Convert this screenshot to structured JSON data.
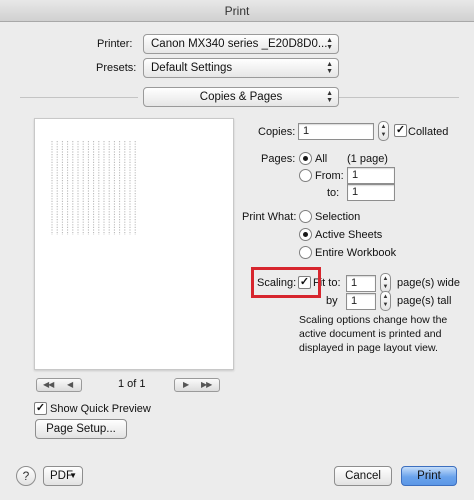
{
  "window": {
    "title": "Print"
  },
  "printer": {
    "label": "Printer:",
    "value": "Canon MX340 series _E20D8D0..."
  },
  "presets": {
    "label": "Presets:",
    "value": "Default Settings"
  },
  "section_popup": {
    "value": "Copies & Pages"
  },
  "pager": {
    "first": "◀◀",
    "prev": "◀",
    "page": "1 of 1",
    "next": "▶",
    "last": "▶▶"
  },
  "quick_preview": {
    "label": "Show Quick Preview",
    "checked": true
  },
  "page_setup": {
    "label": "Page Setup..."
  },
  "copies": {
    "label": "Copies:",
    "value": "1",
    "collated_label": "Collated",
    "collated": true
  },
  "pages": {
    "label": "Pages:",
    "all_label": "All",
    "all_count": "(1 page)",
    "from_label": "From:",
    "from_value": "1",
    "to_label": "to:",
    "to_value": "1"
  },
  "print_what": {
    "label": "Print What:",
    "options": [
      "Selection",
      "Active Sheets",
      "Entire Workbook"
    ],
    "selected": "Active Sheets"
  },
  "scaling": {
    "label": "Scaling:",
    "fit_to_label": "Fit to:",
    "fit_to_checked": true,
    "wide_value": "1",
    "wide_label": "page(s) wide",
    "by_label": "by",
    "tall_value": "1",
    "tall_label": "page(s) tall",
    "note_line1": "Scaling options change how the",
    "note_line2": "active document is printed and",
    "note_line3": "displayed in page layout view."
  },
  "footer": {
    "help": "?",
    "pdf_label": "PDF",
    "cancel_label": "Cancel",
    "print_label": "Print"
  },
  "colors": {
    "highlight_box": "#d7262e",
    "default_button": "#5b97e6"
  }
}
